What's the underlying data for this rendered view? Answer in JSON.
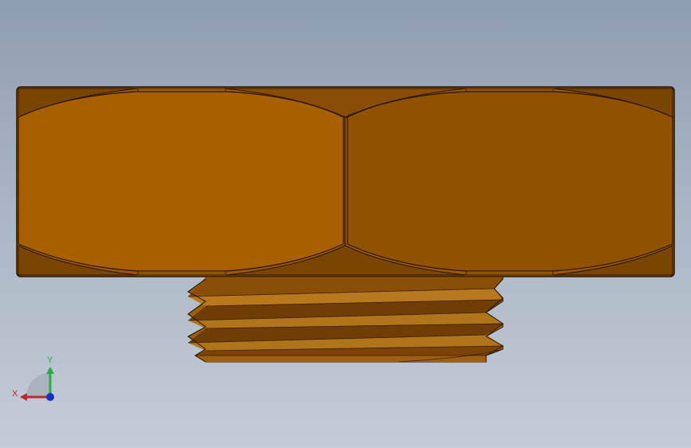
{
  "triad": {
    "x_label": "X",
    "y_label": "Y",
    "x_color": "#c0282d",
    "y_color": "#2aa84a",
    "z_color": "#1b2fbf"
  },
  "model": {
    "hex_light": "#a85f00",
    "hex_dark": "#8e5200",
    "chamfer_light": "#9b5a08",
    "chamfer_dark": "#7a4403",
    "thread_light": "#b0741a",
    "thread_dark": "#6c3b05",
    "edge": "#2a1600"
  }
}
